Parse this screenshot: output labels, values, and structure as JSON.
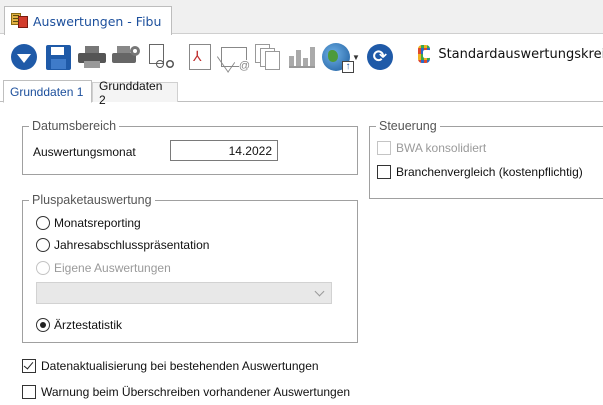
{
  "window": {
    "tab_title": "Auswertungen - Fibu"
  },
  "toolbar": {
    "report_selector_value": "Standardauswertungskreis",
    "icons": [
      "down-circle-icon",
      "save-icon",
      "print-icon",
      "print-setup-icon",
      "preview-icon",
      "pdf-icon",
      "email-icon",
      "documents-icon",
      "chart-icon",
      "globe-upload-icon",
      "refresh-icon",
      "report-set-icon"
    ]
  },
  "tabs": [
    {
      "label": "Grunddaten 1",
      "active": true
    },
    {
      "label": "Grunddaten 2",
      "active": false
    }
  ],
  "datumsbereich": {
    "legend": "Datumsbereich",
    "month_label": "Auswertungsmonat",
    "month_value": "14.2022"
  },
  "steuerung": {
    "legend": "Steuerung",
    "bwa_label": "BWA konsolidiert",
    "bwa_checked": false,
    "bwa_enabled": false,
    "branche_label": "Branchenvergleich (kostenpflichtig)",
    "branche_checked": false
  },
  "pluspaket": {
    "legend": "Pluspaketauswertung",
    "options": [
      {
        "label": "Monatsreporting",
        "selected": false,
        "enabled": true
      },
      {
        "label": "Jahresabschlusspräsentation",
        "selected": false,
        "enabled": true
      },
      {
        "label": "Eigene Auswertungen",
        "selected": false,
        "enabled": false
      },
      {
        "label": "Ärztestatistik",
        "selected": true,
        "enabled": true
      }
    ],
    "combo_value": ""
  },
  "bottom": {
    "datenaktualisierung_label": "Datenaktualisierung bei bestehenden Auswertungen",
    "datenaktualisierung_checked": true,
    "warnung_label": "Warnung beim Überschreiben vorhandener Auswertungen",
    "warnung_checked": false
  },
  "colors": {
    "accent": "#1f5aa8",
    "tab_text": "#1c4f9c",
    "disabled": "#9a9a9a"
  }
}
